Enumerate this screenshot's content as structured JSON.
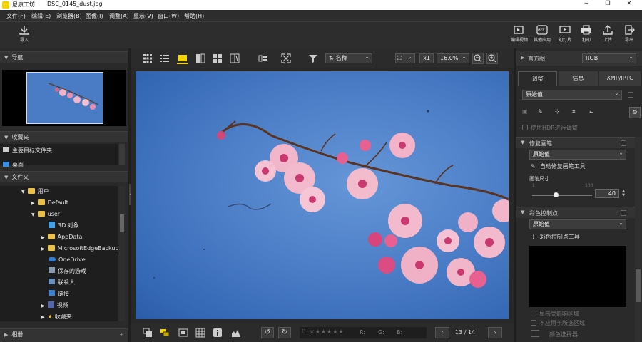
{
  "window": {
    "app_name": "尼康工坊",
    "file_name": "DSC_0145_dust.jpg"
  },
  "menu": [
    "文件(F)",
    "编辑(E)",
    "浏览器(B)",
    "图像(I)",
    "调整(A)",
    "显示(V)",
    "窗口(W)",
    "帮助(H)"
  ],
  "toolbar": {
    "import_label": "导入",
    "right_buttons": [
      "编辑视频",
      "其他应用",
      "幻灯片",
      "打印",
      "上传",
      "导出"
    ],
    "app_badge": "APP"
  },
  "left": {
    "navigation_title": "导航",
    "favorites_title": "收藏夹",
    "favorites_items": [
      "主要目标文件夹",
      "桌面"
    ],
    "folders_title": "文件夹",
    "tree": [
      {
        "label": "用户",
        "level": 1,
        "expanded": true
      },
      {
        "label": "Default",
        "level": 2,
        "expanded": false
      },
      {
        "label": "user",
        "level": 2,
        "expanded": true
      },
      {
        "label": "3D 对象",
        "level": 3,
        "expanded": false
      },
      {
        "label": "AppData",
        "level": 3,
        "expanded": false
      },
      {
        "label": "MicrosoftEdgeBackups",
        "level": 3,
        "expanded": false
      },
      {
        "label": "OneDrive",
        "level": 3,
        "expanded": false
      },
      {
        "label": "保存的游戏",
        "level": 3,
        "expanded": false
      },
      {
        "label": "联系人",
        "level": 3,
        "expanded": false
      },
      {
        "label": "链接",
        "level": 3,
        "expanded": false
      },
      {
        "label": "视频",
        "level": 3,
        "expanded": false
      },
      {
        "label": "收藏夹",
        "level": 3,
        "expanded": false
      }
    ],
    "albums_title": "相册"
  },
  "center": {
    "sort_label": "名称",
    "zoom_multiplier": "x1",
    "zoom_percent": "16.0%",
    "rgb_labels": [
      "R:",
      "G:",
      "B:"
    ],
    "page_indicator": "13 / 14"
  },
  "right": {
    "histogram_title": "直方图",
    "histogram_channel": "RGB",
    "tabs": [
      "调整",
      "信息",
      "XMP/IPTC"
    ],
    "preset_value": "原始值",
    "hdr_label": "使用HDR进行调整",
    "retouch": {
      "title": "修复画笔",
      "preset": "原始值",
      "auto_tool": "自动修复画笔工具",
      "brush_size_label": "画笔尺寸",
      "min": "1",
      "max": "100",
      "value": "40"
    },
    "color_control": {
      "title": "彩色控制点",
      "preset": "原始值",
      "tool": "彩色控制点工具"
    },
    "show_affected": "显示受影响区域",
    "not_applied": "不应用于所选区域",
    "color_picker": "颜色选择器"
  },
  "colors": {
    "accent": "#f5d300",
    "panel": "#2a2a2a",
    "sky": "#4d7fc8"
  }
}
